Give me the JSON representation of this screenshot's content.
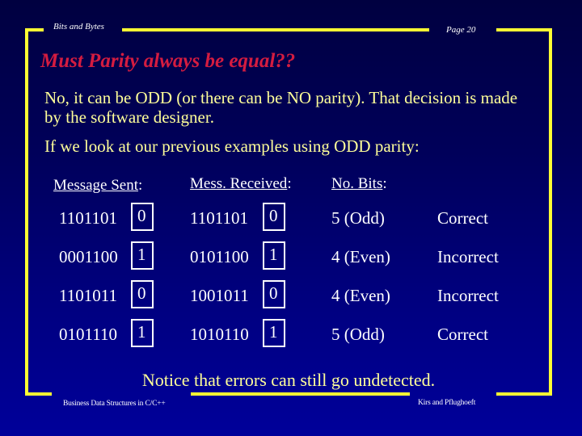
{
  "header": {
    "left_label": "Bits and Bytes",
    "page_label": "Page 20"
  },
  "footer": {
    "left_label": "Business Data Structures in C/C++",
    "right_label": "Kirs and Pflughoeft"
  },
  "slide": {
    "title": "Must Parity always be equal??",
    "paragraph1": "No, it can be ODD (or there can be NO parity). That decision is made by the software designer.",
    "paragraph2": "If we look at our previous examples using ODD parity:",
    "notice": "Notice that errors can still go undetected."
  },
  "table": {
    "headers": [
      {
        "label": "Message Sent",
        "suffix": ":"
      },
      {
        "label": "Mess. Received",
        "suffix": ":"
      },
      {
        "label": "No. Bits",
        "suffix": ":"
      }
    ],
    "rows": [
      {
        "sent_data": "1101101",
        "sent_parity": "0",
        "recv_data": "1101101",
        "recv_parity": "0",
        "bits": "5 (Odd)",
        "result": "Correct"
      },
      {
        "sent_data": "0001100",
        "sent_parity": "1",
        "recv_data": "0101100",
        "recv_parity": "1",
        "bits": "4 (Even)",
        "result": "Incorrect"
      },
      {
        "sent_data": "1101011",
        "sent_parity": "0",
        "recv_data": "1001011",
        "recv_parity": "0",
        "bits": "4 (Even)",
        "result": "Incorrect"
      },
      {
        "sent_data": "0101110",
        "sent_parity": "1",
        "recv_data": "1010110",
        "recv_parity": "1",
        "bits": "5 (Odd)",
        "result": "Correct"
      }
    ]
  },
  "colors": {
    "frame": "#ffff33",
    "title": "#d41c40",
    "body_text": "#ffff99",
    "table_text": "#ffffff",
    "background_top": "#000040",
    "background_bottom": "#00009a"
  }
}
